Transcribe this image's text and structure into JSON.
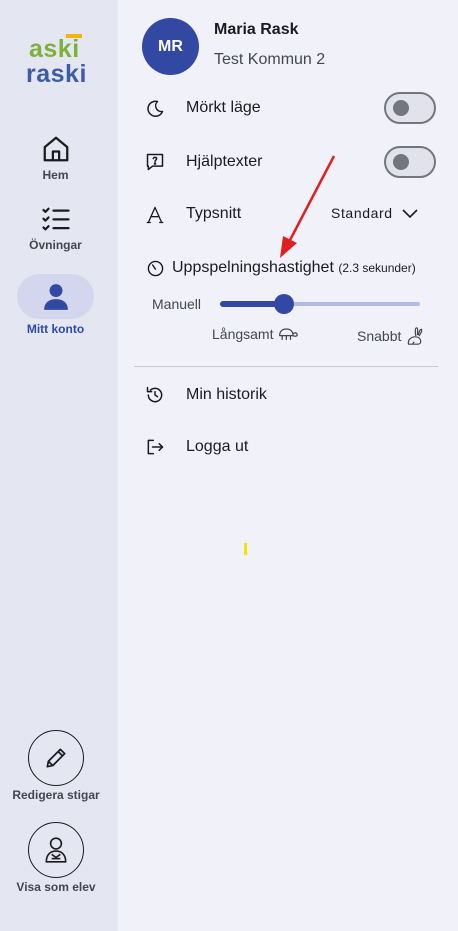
{
  "sidebar": {
    "logo": {
      "line1": "aski",
      "line2": "raski"
    },
    "nav": [
      {
        "label": "Hem",
        "icon": "home-icon"
      },
      {
        "label": "Övningar",
        "icon": "checklist-icon"
      },
      {
        "label": "Mitt konto",
        "icon": "person-icon",
        "active": true
      }
    ],
    "bottom": [
      {
        "label": "Redigera stigar",
        "icon": "pencil-icon"
      },
      {
        "label": "Visa som elev",
        "icon": "student-icon"
      }
    ]
  },
  "profile": {
    "initials": "MR",
    "name": "Maria Rask",
    "organization": "Test Kommun 2"
  },
  "settings": {
    "dark_mode": {
      "label": "Mörkt läge",
      "icon": "moon-icon",
      "enabled": false
    },
    "help_texts": {
      "label": "Hjälptexter",
      "icon": "help-icon",
      "enabled": false
    },
    "font": {
      "label": "Typsnitt",
      "icon": "font-icon",
      "value": "Standard"
    },
    "speed": {
      "label": "Uppspelningshastighet",
      "detail": "(2.3 sekunder)",
      "left_label": "Manuell",
      "slow_label": "Långsamt",
      "fast_label": "Snabbt",
      "level": 0.32
    }
  },
  "menu": {
    "history": {
      "label": "Min historik",
      "icon": "history-icon"
    },
    "logout": {
      "label": "Logga ut",
      "icon": "logout-icon"
    }
  },
  "colors": {
    "primary": "#3348a3",
    "sidebar_bg": "#e4e6f2",
    "panel_bg": "#f1f2f9",
    "annotation": "#e02020"
  }
}
